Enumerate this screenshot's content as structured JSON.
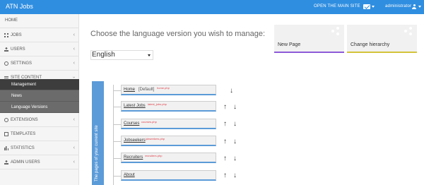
{
  "app": {
    "title": "ATN Jobs",
    "open_site": "OPEN THE MAIN SITE",
    "user": "administrator"
  },
  "sidebar": {
    "home": "HOME",
    "items": [
      {
        "label": "JOBS",
        "icon": "grid-icon"
      },
      {
        "label": "USERS",
        "icon": "user-icon"
      },
      {
        "label": "SETTINGS",
        "icon": "gear-icon"
      },
      {
        "label": "SITE CONTENT",
        "icon": "site-icon"
      },
      {
        "label": "EXTENSIONS",
        "icon": "circle-icon"
      },
      {
        "label": "TEMPLATES",
        "icon": "box-icon"
      },
      {
        "label": "STATISTICS",
        "icon": "bar-chart-icon"
      },
      {
        "label": "ADMIN USERS",
        "icon": "admin-icon"
      }
    ],
    "sub_items": [
      "Management",
      "News",
      "Language Versions"
    ]
  },
  "main": {
    "heading": "Choose the language version you wish to manage:",
    "language": "English",
    "cards": [
      {
        "label": "New Page",
        "accent": "#8e5bd8"
      },
      {
        "label": "Change hierarchy",
        "accent": "#d4c23a"
      }
    ],
    "tree_label": "The pages of your current site",
    "pages": [
      {
        "name": "Home",
        "tag": "[Default]",
        "file": "home.php"
      },
      {
        "name": "Latest Jobs",
        "tag": "",
        "file": "latest_jobs.php"
      },
      {
        "name": "Courses",
        "tag": "",
        "file": "courses.php"
      },
      {
        "name": "Jobseekers",
        "tag": "",
        "file": "jobseekers.php"
      },
      {
        "name": "Recruiters",
        "tag": "",
        "file": "recruiters.php"
      },
      {
        "name": "About",
        "tag": "",
        "file": ""
      }
    ]
  },
  "colors": {
    "topbar": "#2f8ee0",
    "tree_panel": "#5b9bd8",
    "sidebar_active": "#3d3d3d",
    "sidebar_sub": "#6b6b6b"
  }
}
